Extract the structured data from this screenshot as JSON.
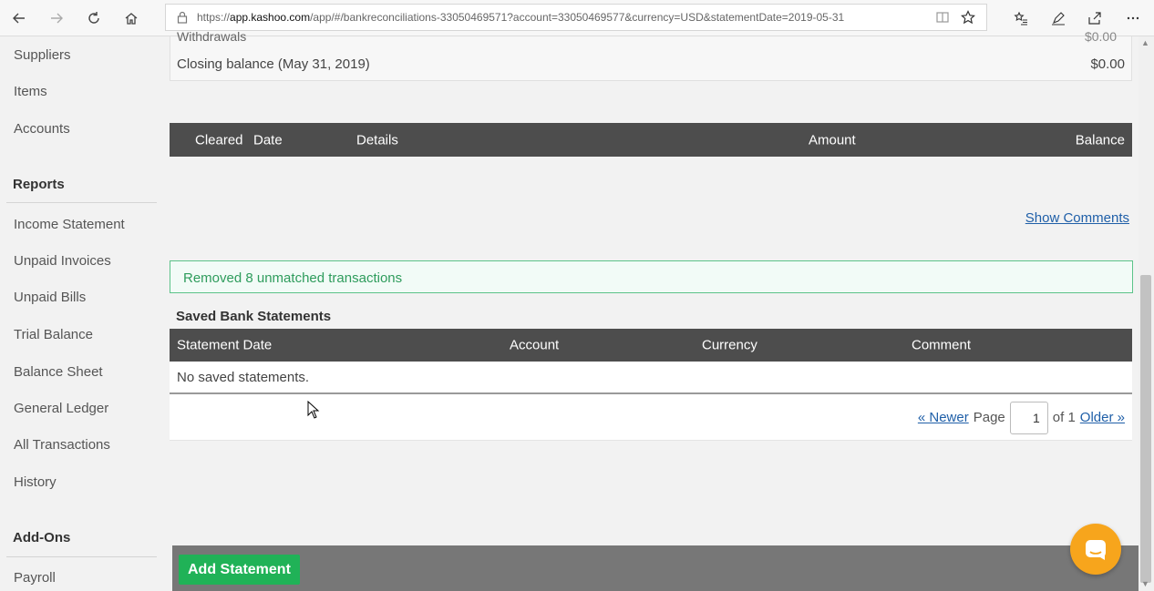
{
  "browser": {
    "url_prefix": "https://",
    "url_domain": "app.kashoo.com",
    "url_path": "/app/#/bankreconciliations-33050469571?account=33050469577&currency=USD&statementDate=2019-05-31"
  },
  "sidebar": {
    "items_top": [
      "Suppliers",
      "Items",
      "Accounts"
    ],
    "reports_heading": "Reports",
    "reports": [
      "Income Statement",
      "Unpaid Invoices",
      "Unpaid Bills",
      "Trial Balance",
      "Balance Sheet",
      "General Ledger",
      "All Transactions",
      "History"
    ],
    "addons_heading": "Add-Ons",
    "addons": [
      "Payroll"
    ]
  },
  "summary": {
    "cut_label": "Withdrawals",
    "cut_value": "$0.00",
    "closing_label": "Closing balance (May 31, 2019)",
    "closing_value": "$0.00"
  },
  "transactions_table": {
    "columns": [
      "Cleared",
      "Date",
      "Details",
      "Amount",
      "Balance"
    ]
  },
  "show_comments": "Show Comments",
  "alert": {
    "message": "Removed 8 unmatched transactions",
    "color": "#2e9c5c"
  },
  "saved_statements": {
    "title": "Saved Bank Statements",
    "columns": [
      "Statement Date",
      "Account",
      "Currency",
      "Comment"
    ],
    "empty_message": "No saved statements."
  },
  "pager": {
    "newer": "« Newer",
    "page_label": "Page",
    "page_value": "1",
    "of_label": "of 1",
    "older": "Older »"
  },
  "add_statement_button": "Add Statement",
  "colors": {
    "header_dark": "#4d4d4d",
    "primary_green": "#20b257",
    "link_blue": "#1f5fa8",
    "chat_orange": "#f7a51c"
  }
}
